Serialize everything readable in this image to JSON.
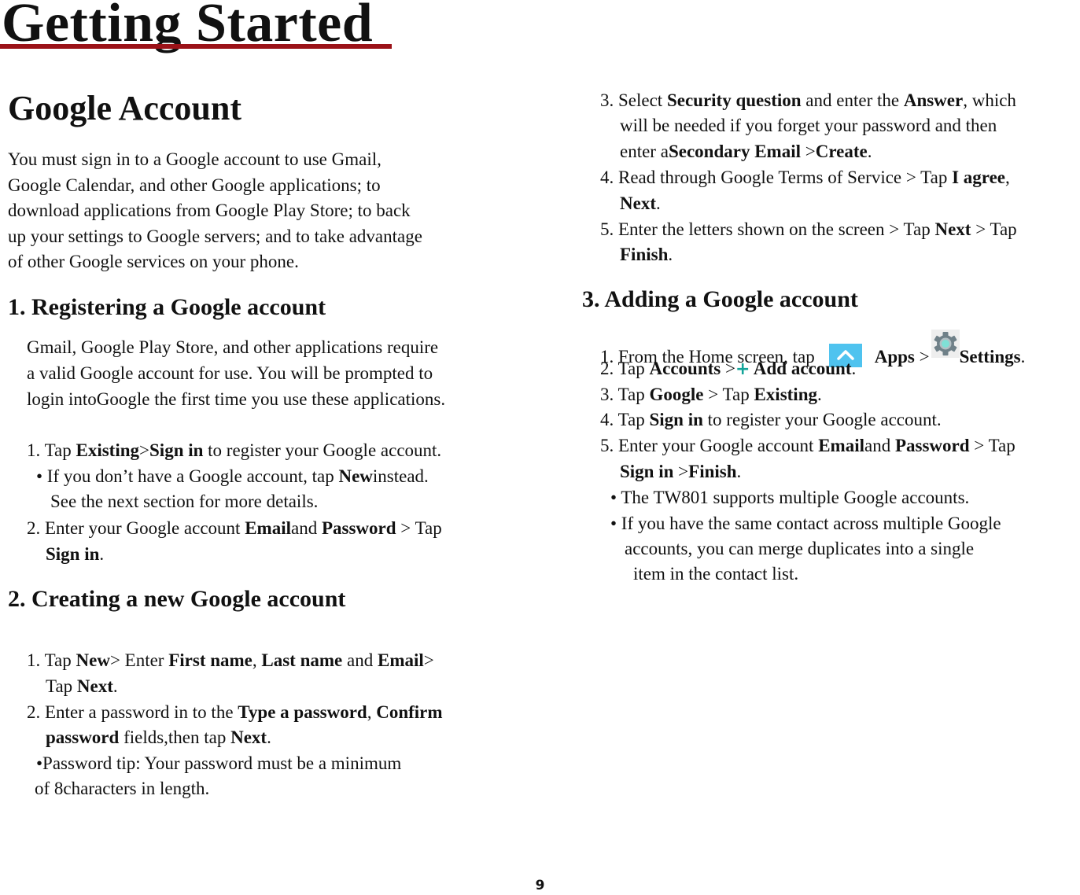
{
  "page": {
    "title": "Getting Started",
    "page_number": "9",
    "accent_color": "#9b1218"
  },
  "left": {
    "heading": "Google Account",
    "intro": [
      "You must sign in to a Google account to use Gmail,",
      "Google Calendar, and other Google applications; to",
      "download applications from Google Play Store; to back",
      "up your settings to Google servers; and to take advantage",
      "of other Google services on your phone."
    ],
    "s1": {
      "heading": "1. Registering a Google account",
      "para": [
        "Gmail, Google Play Store, and other applications require",
        "a valid Google account for use. You will be prompted to",
        "login intoGoogle the first time you use these applications."
      ],
      "step1": {
        "a": "1. Tap ",
        "b1": "Existing",
        "c": ">",
        "b2": "Sign in",
        "d": " to register your Google account."
      },
      "bullet1": {
        "a": "• If you don’t have a Google account, tap ",
        "b": "New",
        "c": "instead."
      },
      "bullet1_cont": "See the next section for more details.",
      "step2": {
        "a": "2. Enter your Google account ",
        "b1": "Email",
        "c": "and ",
        "b2": "Password",
        "d": " > Tap"
      },
      "step2_cont": {
        "b": "Sign in",
        "c": "."
      }
    },
    "s2": {
      "heading": "2. Creating a new Google account",
      "step1": {
        "a": "1. Tap ",
        "b1": "New",
        "c": "> Enter ",
        "b2": "First name",
        "d": ", ",
        "b3": "Last name",
        "e": " and ",
        "b4": "Email",
        "f": ">"
      },
      "step1_cont": {
        "a": "Tap ",
        "b": "Next",
        "c": "."
      },
      "step2": {
        "a": "2. Enter a password in to the ",
        "b1": "Type a password",
        "c": ", ",
        "b2": "Confirm"
      },
      "step2_cont": {
        "b": "password",
        "c": " fields,then tap ",
        "b2": "Next",
        "d": "."
      },
      "tip": "•Password tip: Your password must be a minimum",
      "tip_cont": "of 8characters in length."
    }
  },
  "right": {
    "s2_cont": {
      "step3": {
        "a": "3. Select ",
        "b1": "Security question",
        "c": " and enter the ",
        "b2": "Answer",
        "d": ", which"
      },
      "step3_l2": "will be needed if you forget your password and then",
      "step3_l3": {
        "a": "enter a",
        "b1": "Secondary Email",
        "c": " >",
        "b2": "Create",
        "d": "."
      },
      "step4": {
        "a": "4. Read through Google Terms of Service > Tap ",
        "b": "I agree",
        "c": ","
      },
      "step4_cont": {
        "b": "Next",
        "c": "."
      },
      "step5": {
        "a": "5. Enter the letters shown on the screen > Tap ",
        "b": "Next",
        "c": " > Tap"
      },
      "step5_cont": {
        "b": "Finish",
        "c": "."
      }
    },
    "s3": {
      "heading": "3. Adding a Google account",
      "step1": {
        "a": "1. From the Home screen, tap",
        "b1": "Apps",
        "c": " >",
        "b2": "Settings",
        "d": "."
      },
      "step2": {
        "a": "2. Tap ",
        "b1": "Accounts",
        "c": " >",
        "plus": "+",
        "b2": " Add account",
        "d": "."
      },
      "step3": {
        "a": "3. Tap ",
        "b1": "Google",
        "c": " > Tap ",
        "b2": "Existing",
        "d": "."
      },
      "step4": {
        "a": "4. Tap ",
        "b": "Sign in",
        "c": " to register your Google account."
      },
      "step5": {
        "a": "5. Enter your Google account ",
        "b1": "Email",
        "c": "and ",
        "b2": "Password",
        "d": " > Tap"
      },
      "step5_cont": {
        "b1": "Sign in",
        "c": " >",
        "b2": "Finish",
        "d": "."
      },
      "bullet1": "• The TW801 supports multiple Google accounts.",
      "bullet2": "• If you have the same contact across multiple Google",
      "bullet2_l2": "accounts, you can merge duplicates into a single",
      "bullet2_l3": "item in the contact list."
    }
  }
}
